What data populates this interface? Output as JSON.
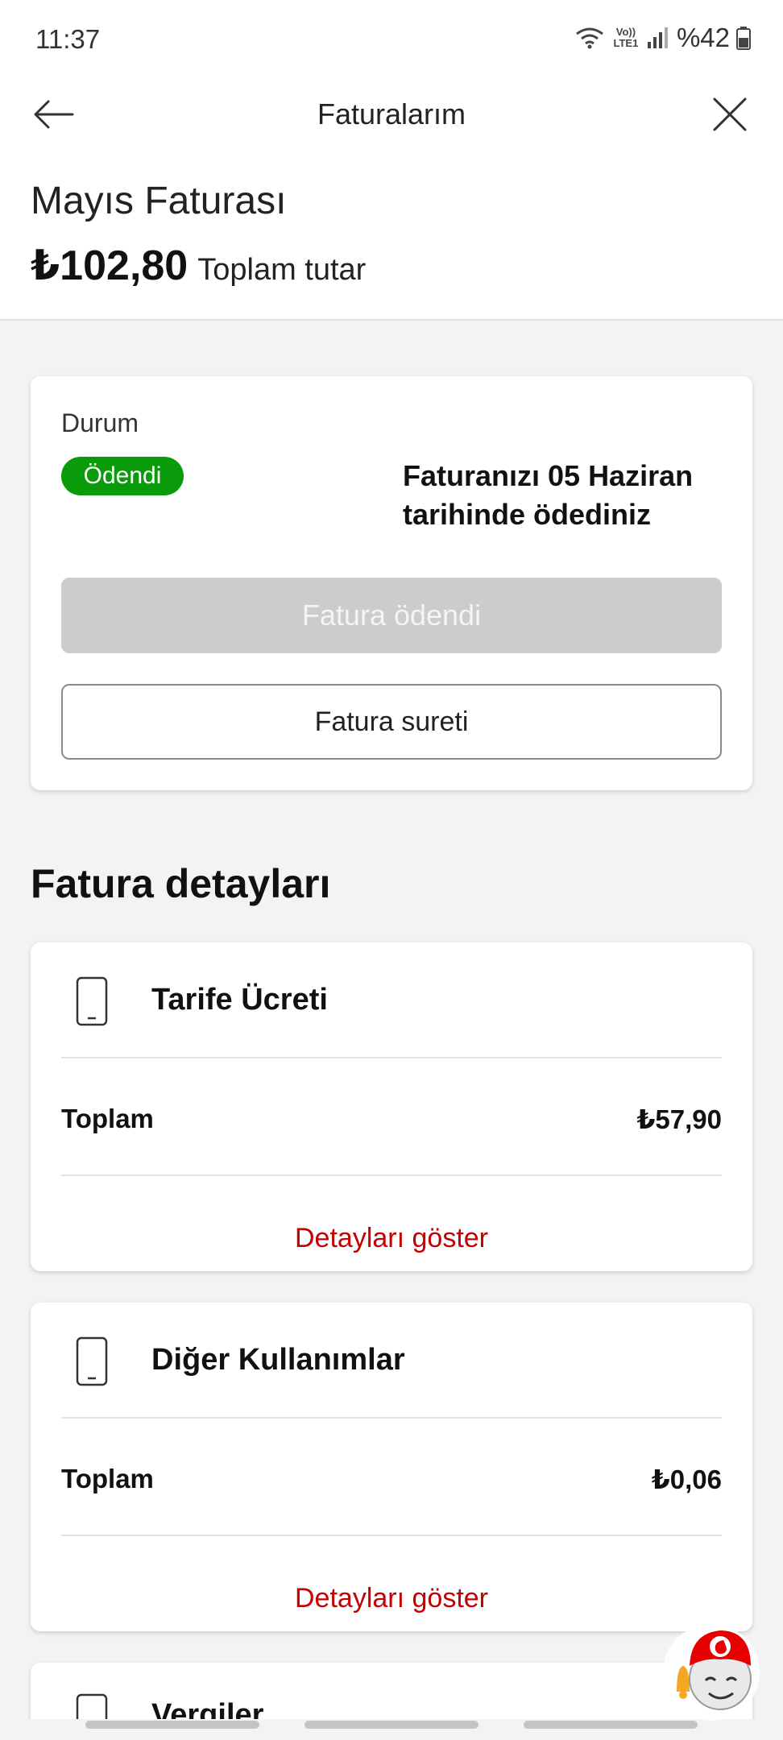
{
  "status_bar": {
    "time": "11:37",
    "battery": "%42",
    "network_label": "Vo)) LTE1"
  },
  "navbar": {
    "title": "Faturalarım"
  },
  "bill": {
    "month_title": "Mayıs Faturası",
    "amount": "₺102,80",
    "amount_label": "Toplam tutar"
  },
  "status_card": {
    "label": "Durum",
    "badge": "Ödendi",
    "message": "Faturanızı 05 Haziran tarihinde ödediniz",
    "primary_button": "Fatura ödendi",
    "secondary_button": "Fatura sureti"
  },
  "details": {
    "section_title": "Fatura detayları",
    "items": [
      {
        "title": "Tarife Ücreti",
        "total_label": "Toplam",
        "total_value": "₺57,90",
        "link": "Detayları göster"
      },
      {
        "title": "Diğer Kullanımlar",
        "total_label": "Toplam",
        "total_value": "₺0,06",
        "link": "Detayları göster"
      },
      {
        "title": "Vergiler"
      }
    ]
  },
  "colors": {
    "accent_red": "#c40000",
    "paid_green": "#0a9b0a",
    "disabled_gray": "#cccccc"
  },
  "icons": [
    "wifi-icon",
    "signal-icon",
    "battery-icon",
    "back-arrow-icon",
    "close-icon",
    "phone-icon",
    "chat-assistant-icon"
  ]
}
